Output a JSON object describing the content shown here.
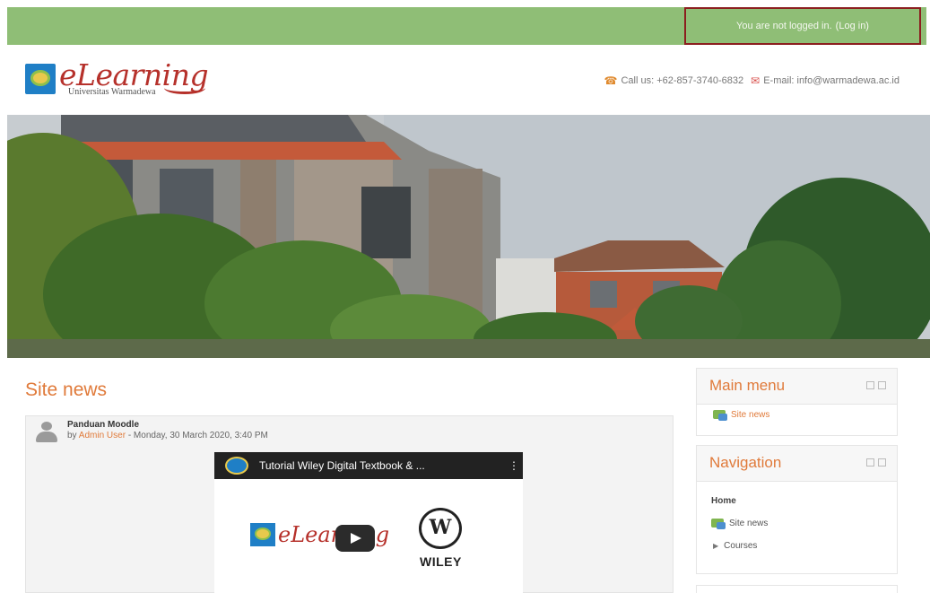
{
  "topbar": {
    "login_text": "You are not logged in.",
    "login_link": "(Log in)"
  },
  "header": {
    "brand": "eLearning",
    "subtitle": "Universitas Warmadewa",
    "phone_label": "Call us: +62-857-3740-6832",
    "email_label": "E-mail: info@warmadewa.ac.id"
  },
  "main": {
    "section_title": "Site news",
    "post": {
      "title": "Panduan Moodle",
      "by_prefix": "by",
      "author": "Admin User",
      "date": "- Monday, 30 March 2020, 3:40 PM",
      "video": {
        "title": "Tutorial Wiley Digital Textbook & ...",
        "menu": "⋮",
        "thumb_brand": "eLearning",
        "partner_logo": "WILEY",
        "partner_mark": "W"
      }
    }
  },
  "sidebar": {
    "main_menu": {
      "title": "Main menu",
      "items": [
        "Site news"
      ]
    },
    "navigation": {
      "title": "Navigation",
      "home": "Home",
      "site_news": "Site news",
      "courses": "Courses"
    }
  },
  "colors": {
    "topbar": "#8fbe76",
    "accent": "#e07a3a",
    "login_border": "#8b1f1f",
    "brand_red": "#b6312b"
  }
}
